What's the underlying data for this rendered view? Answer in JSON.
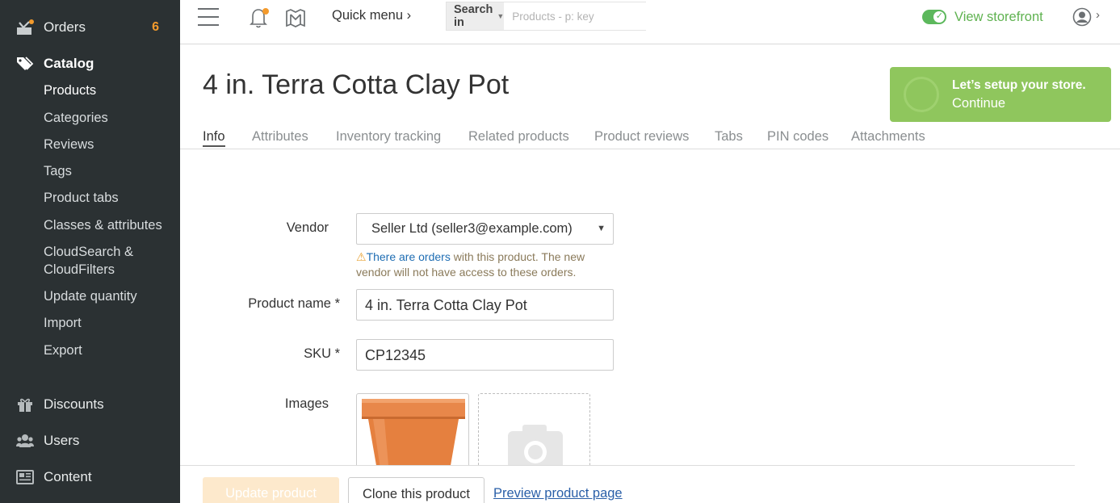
{
  "colors": {
    "sidebar_bg": "#2b3133",
    "accent_orange": "#f39a2c",
    "storefront_green": "#5fb250",
    "setup_banner": "#8fc65d",
    "link_blue": "#1e6db3"
  },
  "sidebar": {
    "orders": {
      "label": "Orders",
      "badge": "6",
      "icon": "orders-icon"
    },
    "catalog": {
      "label": "Catalog",
      "icon": "tags-icon",
      "items": [
        "Products",
        "Categories",
        "Reviews",
        "Tags",
        "Product tabs",
        "Classes & attributes",
        "CloudSearch &",
        "CloudFilters",
        "Update quantity",
        "Import",
        "Export"
      ]
    },
    "discounts": {
      "label": "Discounts",
      "icon": "gift-icon"
    },
    "users": {
      "label": "Users",
      "icon": "users-icon"
    },
    "content": {
      "label": "Content",
      "icon": "content-icon"
    }
  },
  "topbar": {
    "quick_menu": "Quick menu ›",
    "search_in": "Search in",
    "search_placeholder": "Products - p: key",
    "view_storefront": "View storefront",
    "user_chevron": "›"
  },
  "page": {
    "title": "4 in. Terra Cotta Clay Pot"
  },
  "setup_banner": {
    "line1": "Let’s setup your store.",
    "line2": "Continue"
  },
  "tabs": [
    "Info",
    "Attributes",
    "Inventory tracking",
    "Related products",
    "Product reviews",
    "Tabs",
    "PIN codes",
    "Attachments"
  ],
  "form": {
    "vendor_label": "Vendor",
    "vendor_value": "Seller Ltd (seller3@example.com)",
    "warning_link": "There are orders",
    "warning_text1": " with this product. The new",
    "warning_text2": "vendor will not have access to these orders.",
    "product_name_label": "Product name *",
    "product_name_value": "4 in. Terra Cotta Clay Pot",
    "sku_label": "SKU *",
    "sku_value": "CP12345",
    "images_label": "Images"
  },
  "footer": {
    "update": "Update product",
    "clone": "Clone this product",
    "preview": "Preview product page"
  }
}
